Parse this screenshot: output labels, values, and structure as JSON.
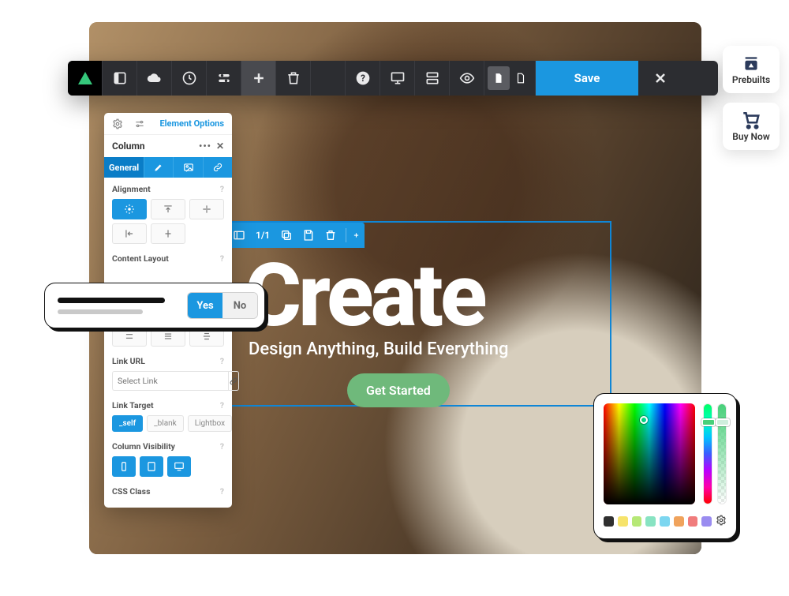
{
  "toolbar": {
    "save_label": "Save",
    "page_indicator": "1/1"
  },
  "side_widgets": {
    "prebuilts": "Prebuilts",
    "buy_now": "Buy Now"
  },
  "hero": {
    "title": "Create",
    "subtitle": "Design Anything, Build Everything",
    "cta": "Get Started"
  },
  "selection_toolbar": {
    "page_count": "1/1"
  },
  "options_panel": {
    "tabs_link": "Element Options",
    "header": "Column",
    "subtabs": {
      "general": "General"
    },
    "alignment_label": "Alignment",
    "content_layout_label": "Content Layout",
    "link_url_label": "Link URL",
    "link_url_placeholder": "Select Link",
    "link_target_label": "Link Target",
    "link_target_options": {
      "self": "_self",
      "blank": "_blank",
      "lightbox": "Lightbox"
    },
    "column_visibility_label": "Column Visibility",
    "css_class_label": "CSS Class"
  },
  "prompt": {
    "yes": "Yes",
    "no": "No"
  },
  "color_picker": {
    "swatches": [
      "#2f2f2f",
      "#f6e36b",
      "#b6e876",
      "#88e3c2",
      "#7cd6f0",
      "#f0a35c",
      "#f07c7c",
      "#9a8cf0"
    ]
  }
}
